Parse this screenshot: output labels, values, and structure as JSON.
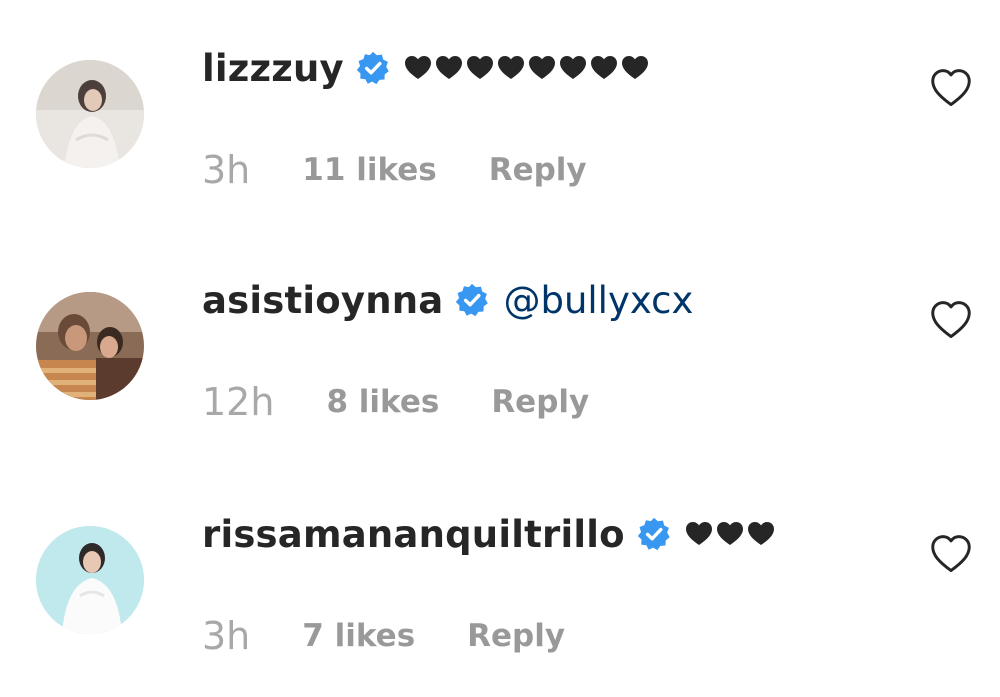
{
  "comments": [
    {
      "username": "lizzzuy",
      "text": "",
      "text_kind": "hearts",
      "heart_count": 8,
      "time": "3h",
      "likes": "11 likes",
      "reply": "Reply",
      "verified": true
    },
    {
      "username": "asistioynna",
      "text": "@bullyxcx",
      "text_kind": "mention",
      "time": "12h",
      "likes": "8 likes",
      "reply": "Reply",
      "verified": true
    },
    {
      "username": "rissamananquiltrillo",
      "text": "",
      "text_kind": "hearts",
      "heart_count": 3,
      "time": "3h",
      "likes": "7 likes",
      "reply": "Reply",
      "verified": true
    }
  ],
  "colors": {
    "verified": "#3897f0",
    "text": "#262626",
    "meta": "#999999",
    "mention": "#003569"
  },
  "icons": {
    "verified": "verified-badge-icon",
    "heart_emoji": "black-heart-icon",
    "like": "heart-outline-icon"
  }
}
